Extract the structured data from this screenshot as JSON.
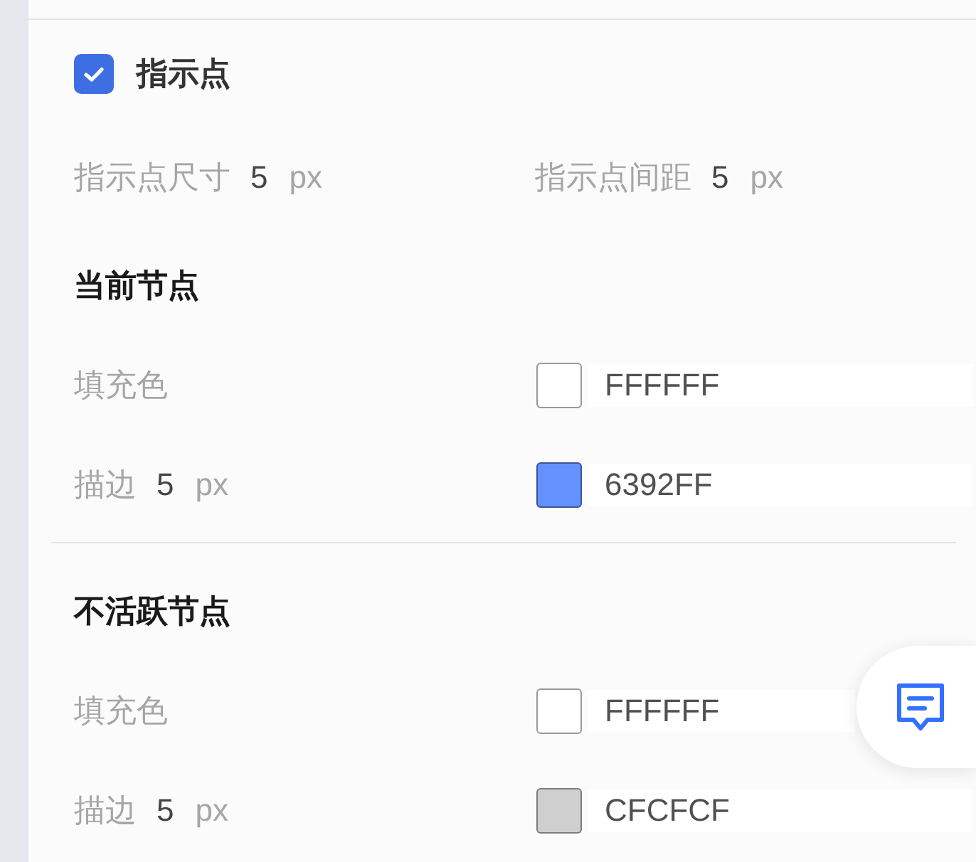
{
  "indicator": {
    "label": "指示点",
    "checked": true,
    "fields": [
      {
        "label": "指示点尺寸",
        "value": "5",
        "unit": "px"
      },
      {
        "label": "指示点间距",
        "value": "5",
        "unit": "px"
      }
    ]
  },
  "sections": [
    {
      "title": "当前节点",
      "rows": [
        {
          "kind": "fill",
          "label": "填充色",
          "color": "#ffffff",
          "hex": "FFFFFF"
        },
        {
          "kind": "stroke",
          "label": "描边",
          "value": "5",
          "unit": "px",
          "color": "#6392ff",
          "hex": "6392FF"
        }
      ]
    },
    {
      "title": "不活跃节点",
      "rows": [
        {
          "kind": "fill",
          "label": "填充色",
          "color": "#ffffff",
          "hex": "FFFFFF"
        },
        {
          "kind": "stroke",
          "label": "描边",
          "value": "5",
          "unit": "px",
          "color": "#cfcfcf",
          "hex": "CFCFCF"
        }
      ]
    }
  ]
}
